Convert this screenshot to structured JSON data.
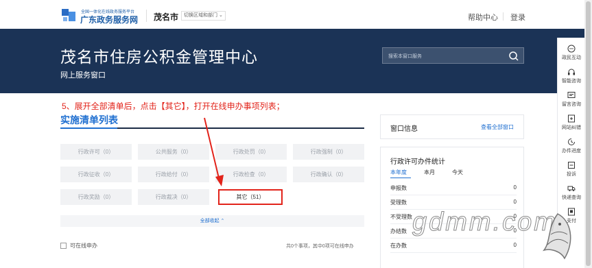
{
  "header": {
    "logo_small": "全国一体化在线政务服务平台",
    "logo_big": "广东政务服务网",
    "city": "茂名市",
    "switch_label": "切换区域和部门",
    "help": "帮助中心",
    "login": "登录"
  },
  "banner": {
    "title": "茂名市住房公积金管理中心",
    "subtitle": "网上服务窗口",
    "search_placeholder": "搜索本窗口服务"
  },
  "annotation": "5、展开全部清单后，点击【其它】，打开在线申办事项列表；",
  "list": {
    "title": "实施清单列表",
    "categories": [
      "行政许可（0）",
      "公共服务（0）",
      "行政处罚（0）",
      "行政强制（0）",
      "行政征收（0）",
      "行政给付（0）",
      "行政检查（0）",
      "行政确认（0）",
      "行政奖励（0）",
      "行政裁决（0）",
      "其它（51）"
    ],
    "collapse": "全部收起 ⌃",
    "online_only": "可在线申办",
    "summary": "共0个事项，其中0项可在线申办"
  },
  "window_info": {
    "title": "窗口信息",
    "link": "查看全部窗口"
  },
  "stats": {
    "title": "行政许可办件统计",
    "tabs": [
      "本年度",
      "本月",
      "今天"
    ],
    "rows": [
      {
        "label": "申报数",
        "value": "0"
      },
      {
        "label": "受理数",
        "value": "0"
      },
      {
        "label": "不受理数",
        "value": "0"
      },
      {
        "label": "办结数",
        "value": "0"
      },
      {
        "label": "在办数",
        "value": "0"
      }
    ]
  },
  "sidebar": [
    {
      "label": "政民互动",
      "icon": "chat-icon"
    },
    {
      "label": "智能咨询",
      "icon": "headset-icon"
    },
    {
      "label": "留言咨询",
      "icon": "message-icon"
    },
    {
      "label": "网站纠错",
      "icon": "correction-icon"
    },
    {
      "label": "办件进度",
      "icon": "progress-icon"
    },
    {
      "label": "投诉",
      "icon": "complaint-icon"
    },
    {
      "label": "快递查询",
      "icon": "truck-icon"
    },
    {
      "label": "支付",
      "icon": "pay-icon"
    }
  ],
  "watermark": "gdmm.com",
  "colors": {
    "banner": "#1b3356",
    "accent": "#1f6fd0",
    "annotation": "#e2231a"
  }
}
